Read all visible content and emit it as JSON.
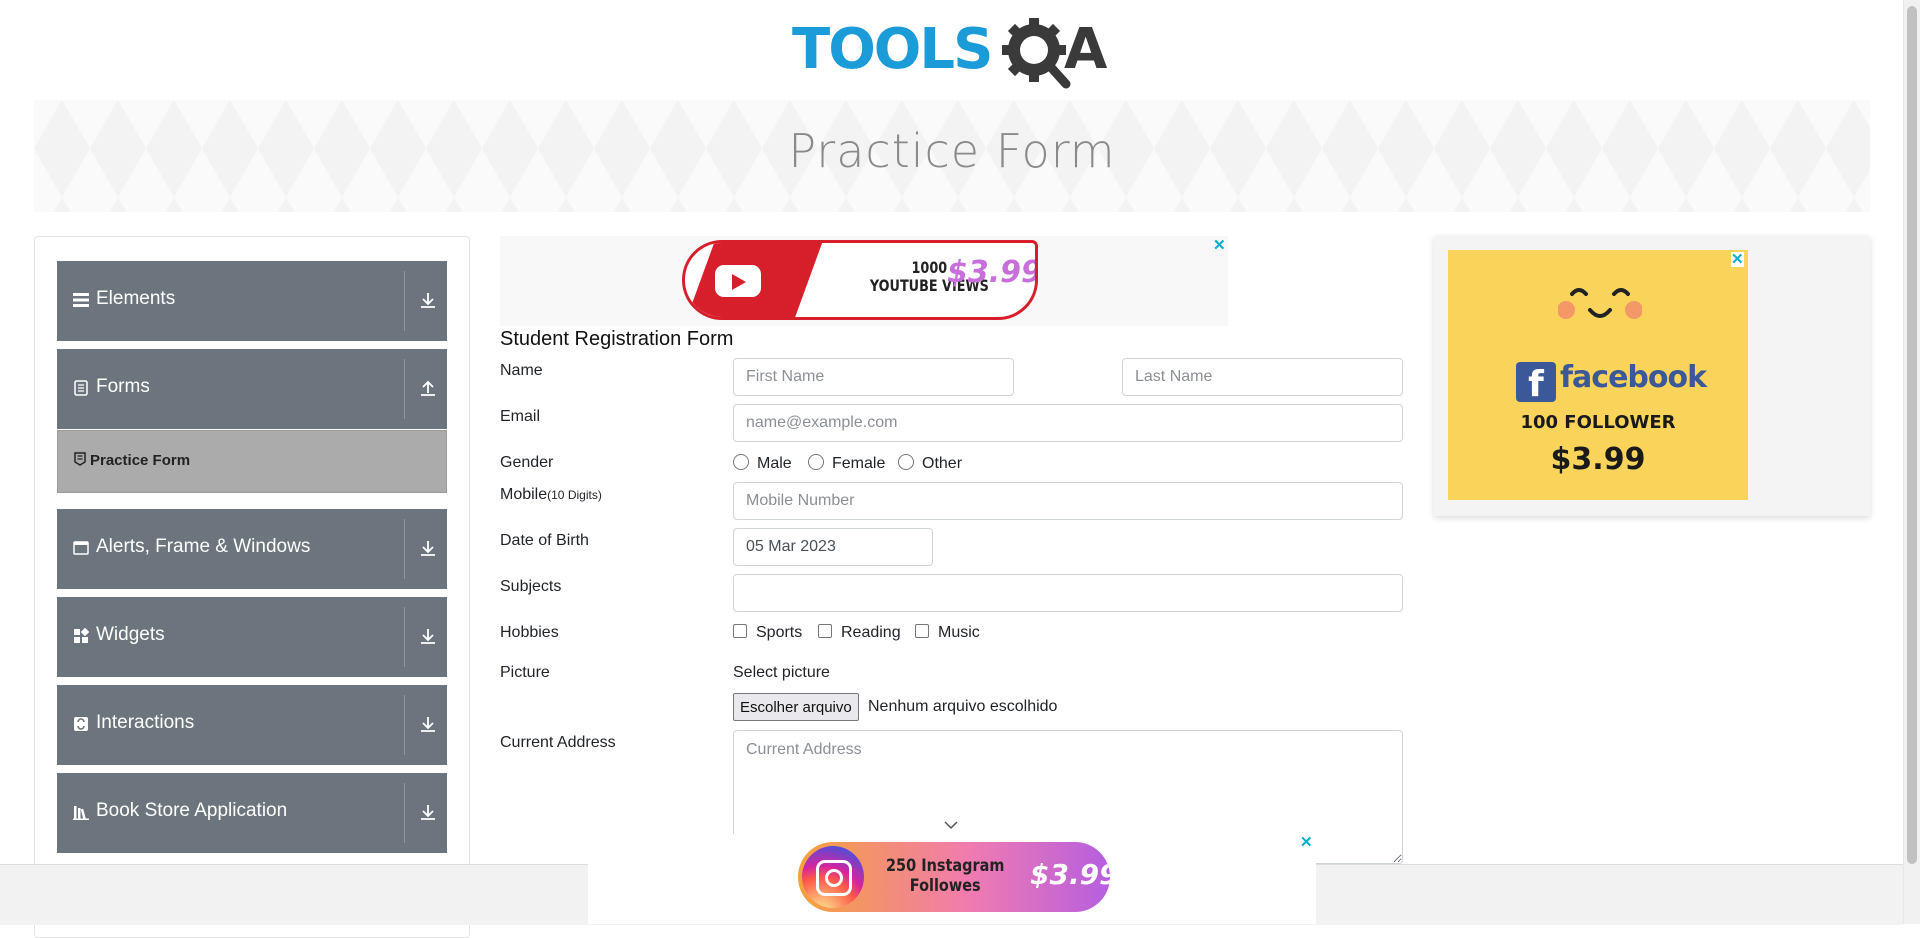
{
  "header": {
    "logo_text_left": "TOOLS",
    "logo_text_right": "A"
  },
  "banner": {
    "title": "Practice Form"
  },
  "sidebar": {
    "groups": [
      {
        "label": "Elements",
        "icon": "menu-bars-icon",
        "arrow": "download-icon"
      },
      {
        "label": "Forms",
        "icon": "document-icon",
        "arrow": "upload-icon"
      },
      {
        "label": "Alerts, Frame & Windows",
        "icon": "window-icon",
        "arrow": "download-icon"
      },
      {
        "label": "Widgets",
        "icon": "widgets-icon",
        "arrow": "download-icon"
      },
      {
        "label": "Interactions",
        "icon": "interactions-icon",
        "arrow": "download-icon"
      },
      {
        "label": "Book Store Application",
        "icon": "books-icon",
        "arrow": "download-icon"
      }
    ],
    "active_item": {
      "label": "Practice Form",
      "icon": "form-icon"
    }
  },
  "ads": {
    "top": {
      "line1": "1000",
      "line2": "YOUTUBE VIEWS",
      "price": "$3.99",
      "close": "✕"
    },
    "right": {
      "brand_letter": "f",
      "brand": "facebook",
      "followers": "100 FOLLOWER",
      "price": "$3.99",
      "close": "✕"
    },
    "bottom": {
      "line1": "250 Instagram",
      "line2": "Followes",
      "price": "$3.99",
      "close": "✕"
    }
  },
  "form": {
    "title": "Student Registration Form",
    "labels": {
      "name": "Name",
      "email": "Email",
      "gender": "Gender",
      "mobile": "Mobile",
      "mobile_hint": "(10 Digits)",
      "dob": "Date of Birth",
      "subjects": "Subjects",
      "hobbies": "Hobbies",
      "picture": "Picture",
      "address": "Current Address"
    },
    "first_name": {
      "placeholder": "First Name",
      "value": ""
    },
    "last_name": {
      "placeholder": "Last Name",
      "value": ""
    },
    "email": {
      "placeholder": "name@example.com",
      "value": ""
    },
    "gender_options": [
      "Male",
      "Female",
      "Other"
    ],
    "mobile": {
      "placeholder": "Mobile Number",
      "value": ""
    },
    "dob": {
      "value": "05 Mar 2023"
    },
    "subjects": {
      "value": ""
    },
    "hobby_options": [
      "Sports",
      "Reading",
      "Music"
    ],
    "picture": {
      "select_label": "Select picture",
      "button": "Escolher arquivo",
      "status": "Nenhum arquivo escolhido"
    },
    "address": {
      "placeholder": "Current Address",
      "value": ""
    }
  },
  "colors": {
    "sidebar_bg": "#6c757d",
    "active_item_bg": "#ababab",
    "logo_blue": "#1b9bd7",
    "ad_close": "#00aecd"
  }
}
